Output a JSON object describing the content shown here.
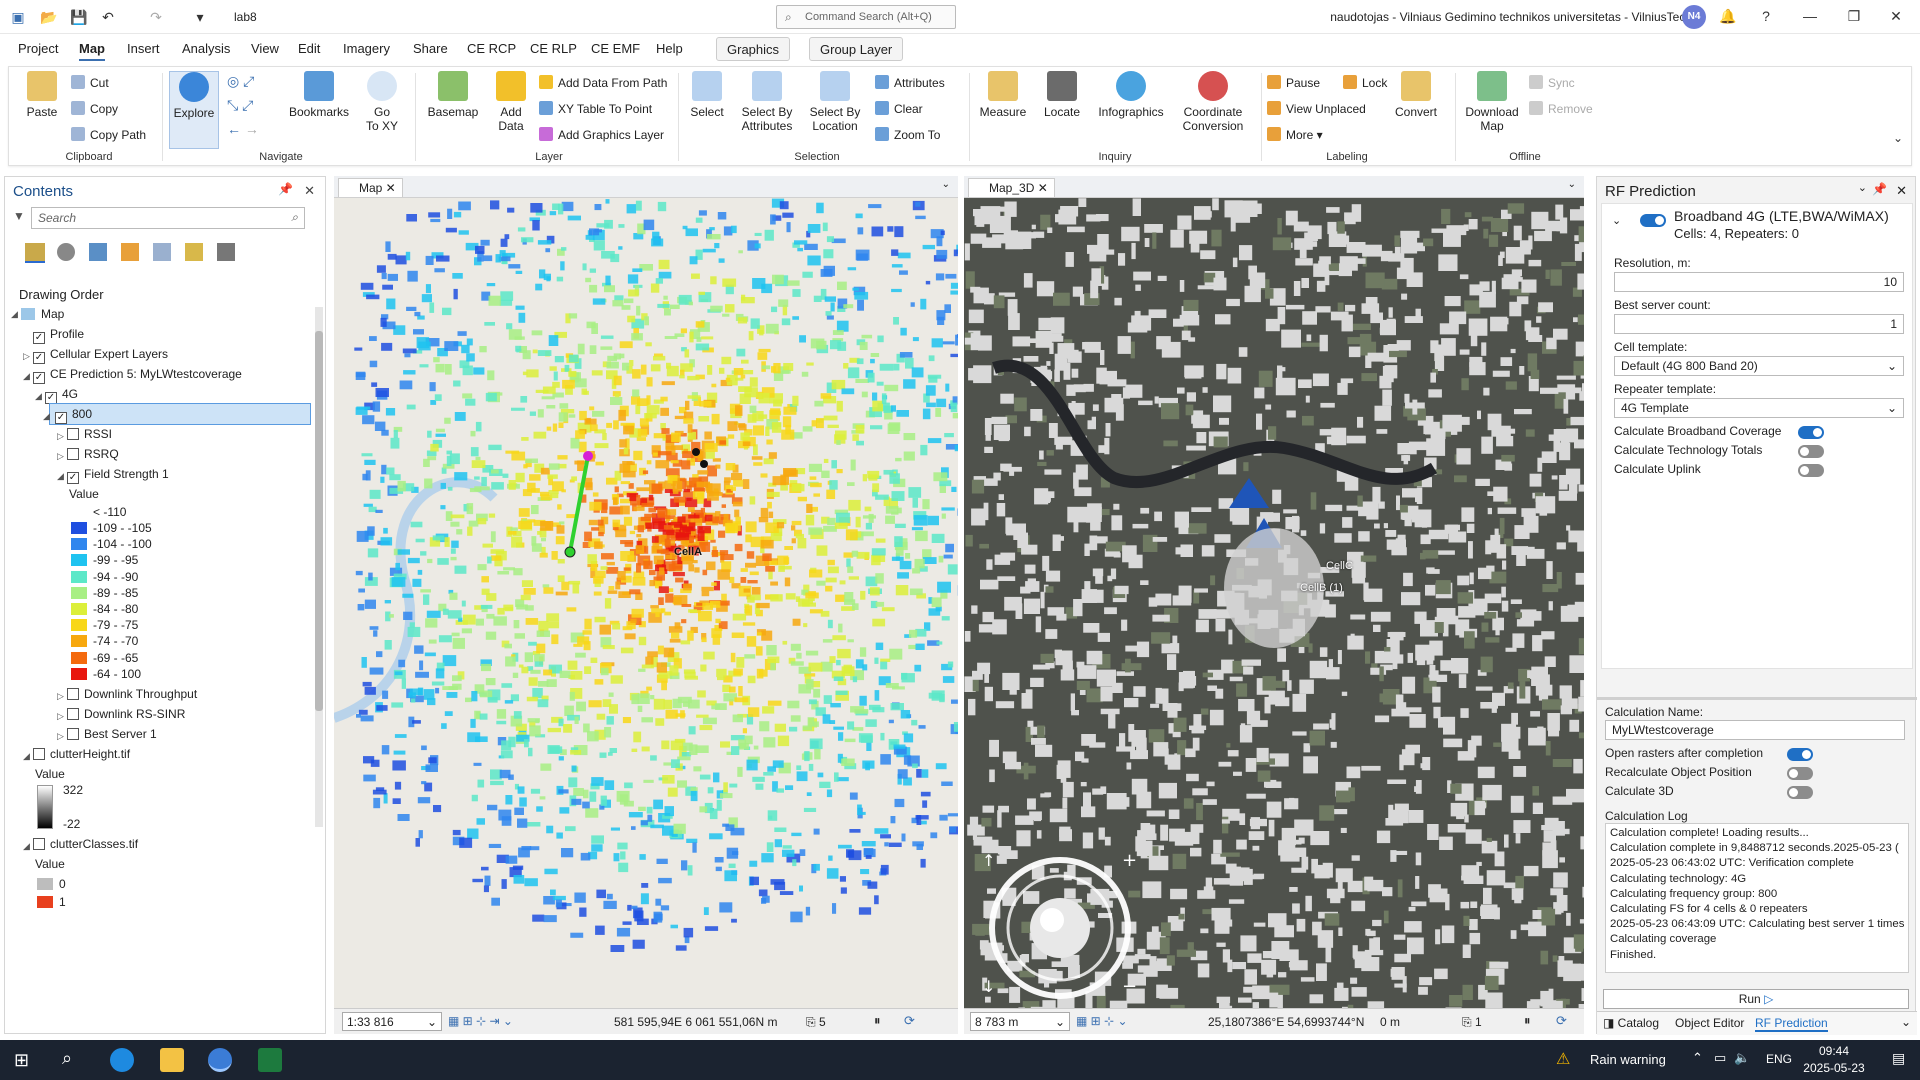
{
  "qat": {
    "project": "lab8",
    "search_placeholder": "Command Search (Alt+Q)",
    "user": "naudotojas - Vilniaus Gedimino technikos universitetas - VilniusTech",
    "initials": "N4"
  },
  "menu": [
    "Project",
    "Map",
    "Insert",
    "Analysis",
    "View",
    "Edit",
    "Imagery",
    "Share",
    "CE RCP",
    "CE RLP",
    "CE EMF",
    "Help"
  ],
  "context_tabs": [
    "Graphics",
    "Group Layer"
  ],
  "ribbon": {
    "clipboard": {
      "paste": "Paste",
      "cut": "Cut",
      "copy": "Copy",
      "copy_path": "Copy Path",
      "label": "Clipboard"
    },
    "navigate": {
      "explore": "Explore",
      "bookmarks": "Bookmarks",
      "goto": "Go To XY",
      "goto1": "Go",
      "goto2": "To XY",
      "label": "Navigate"
    },
    "layer": {
      "basemap": "Basemap",
      "add_data1": "Add",
      "add_data2": "Data",
      "add_path": "Add Data From Path",
      "xy": "XY Table To Point",
      "graphics": "Add Graphics Layer",
      "label": "Layer"
    },
    "selection": {
      "select": "Select",
      "attr1": "Select By",
      "attr2": "Attributes",
      "loc1": "Select By",
      "loc2": "Location",
      "attributes": "Attributes",
      "clear": "Clear",
      "zoom": "Zoom To",
      "label": "Selection"
    },
    "inquiry": {
      "measure": "Measure",
      "locate": "Locate",
      "info": "Infographics",
      "coord1": "Coordinate",
      "coord2": "Conversion",
      "label": "Inquiry"
    },
    "labeling": {
      "pause": "Pause",
      "lock": "Lock",
      "unplaced": "View Unplaced",
      "more": "More",
      "convert": "Convert",
      "label": "Labeling"
    },
    "offline": {
      "dl1": "Download",
      "dl2": "Map",
      "sync": "Sync",
      "remove": "Remove",
      "label": "Offline"
    }
  },
  "contents": {
    "title": "Contents",
    "search": "Search",
    "drawing_order": "Drawing Order",
    "layers": {
      "map": "Map",
      "profile": "Profile",
      "cellular": "Cellular Expert Layers",
      "prediction": "CE Prediction 5: MyLWtestcoverage",
      "g4": "4G",
      "b800": "800",
      "rssi": "RSSI",
      "rsrq": "RSRQ",
      "fs": "Field Strength 1",
      "value": "Value",
      "dl_tp": "Downlink Throughput",
      "dl_sinr": "Downlink RS-SINR",
      "best": "Best Server 1",
      "clutter_h": "clutterHeight.tif",
      "value2": "Value",
      "ch_max": "322",
      "ch_min": "-22",
      "clutter_c": "clutterClasses.tif",
      "value3": "Value",
      "cc0": "0",
      "cc1": "1"
    },
    "legend": [
      {
        "label": "< -110",
        "color": "#ffffff"
      },
      {
        "label": "-109 - -105",
        "color": "#1f4fe0"
      },
      {
        "label": "-104 - -100",
        "color": "#2f86ee"
      },
      {
        "label": "-99 - -95",
        "color": "#1fc3f0"
      },
      {
        "label": "-94 - -90",
        "color": "#5ce8c8"
      },
      {
        "label": "-89 - -85",
        "color": "#a8ef84"
      },
      {
        "label": "-84 - -80",
        "color": "#dcef3a"
      },
      {
        "label": "-79 - -75",
        "color": "#f8d718"
      },
      {
        "label": "-74 - -70",
        "color": "#f7a80e"
      },
      {
        "label": "-69 - -65",
        "color": "#f46a0e"
      },
      {
        "label": "-64 - 100",
        "color": "#e8160e"
      }
    ]
  },
  "map2d": {
    "tab": "Map",
    "scale": "1:33 816",
    "coords": "581 595,94E 6 061 551,06N m",
    "sel_count": "5",
    "cell_label": "CellA"
  },
  "map3d": {
    "tab": "Map_3D",
    "scale": "8 783 m",
    "coords": "25,1807386°E 54,6993744°N",
    "elev": "0 m",
    "sel_count": "1",
    "cellc": "CellC",
    "cellb": "CellB (1)"
  },
  "rf": {
    "title": "RF Prediction",
    "tech": "Broadband 4G (LTE,BWA/WiMAX)",
    "cells": "Cells: 4, Repeaters: 0",
    "res_label": "Resolution, m:",
    "res_val": "10",
    "bsc_label": "Best server count:",
    "bsc_val": "1",
    "cell_tpl_label": "Cell template:",
    "cell_tpl": "Default (4G 800 Band 20)",
    "rep_tpl_label": "Repeater template:",
    "rep_tpl": "4G Template",
    "calc_bb": "Calculate Broadband Coverage",
    "calc_tt": "Calculate Technology Totals",
    "calc_ul": "Calculate Uplink",
    "calc_name_label": "Calculation Name:",
    "calc_name": "MyLWtestcoverage",
    "open_rasters": "Open rasters after completion",
    "recalc": "Recalculate Object Position",
    "calc3d": "Calculate 3D",
    "log_label": "Calculation Log",
    "log": [
      "Calculation complete! Loading results...",
      "Calculation complete in 9,8488712 seconds.2025-05-23 (",
      "2025-05-23 06:43:02 UTC: Verification complete",
      "Calculating technology: 4G",
      "Calculating frequency group: 800",
      "Calculating FS for 4 cells & 0 repeaters",
      "2025-05-23 06:43:09 UTC: Calculating best server 1 times",
      "Calculating coverage",
      "Finished."
    ],
    "run": "Run",
    "bottom_tabs": [
      "Catalog",
      "Object Editor",
      "RF Prediction"
    ]
  },
  "taskbar": {
    "weather": "Rain warning",
    "lang": "ENG",
    "time": "09:44",
    "date": "2025-05-23"
  }
}
